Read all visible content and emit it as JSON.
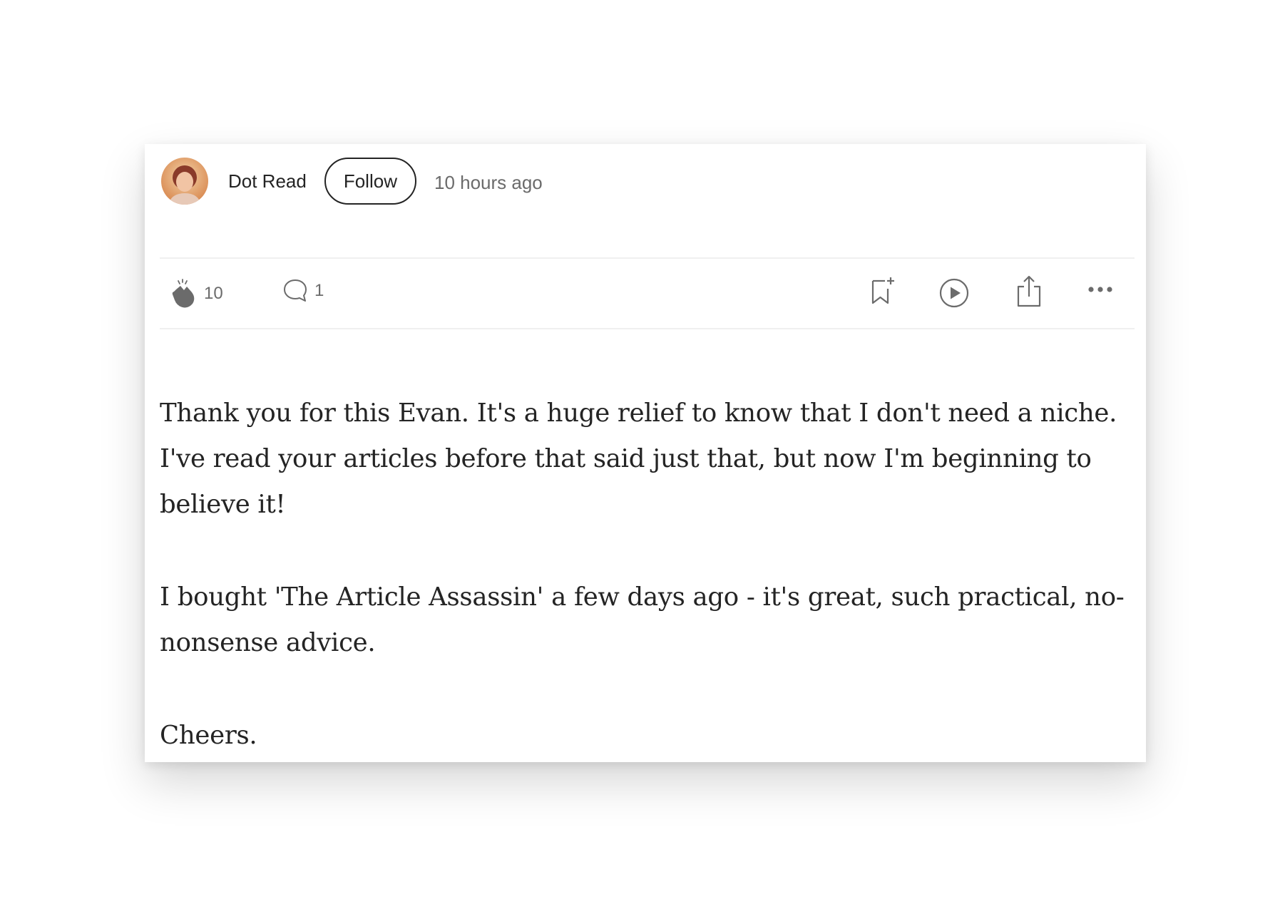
{
  "comment": {
    "author": {
      "name": "Dot Read",
      "follow_label": "Follow"
    },
    "timestamp": "10 hours ago",
    "actions": {
      "clap_count": "10",
      "response_count": "1",
      "icons": [
        "clap-icon",
        "comment-icon",
        "bookmark-add-icon",
        "play-icon",
        "share-icon",
        "more-icon"
      ]
    },
    "paragraphs": [
      "Thank you for this Evan. It's a huge relief to know that I don't need a niche. I've read your articles before that said just that, but now I'm beginning to believe it!",
      "I bought 'The Article Assassin' a few days ago - it's great, such practical, no-nonsense advice.",
      "Cheers."
    ]
  },
  "colors": {
    "text": "#242424",
    "muted": "#6b6b6b",
    "divider": "#f0f0f0"
  }
}
